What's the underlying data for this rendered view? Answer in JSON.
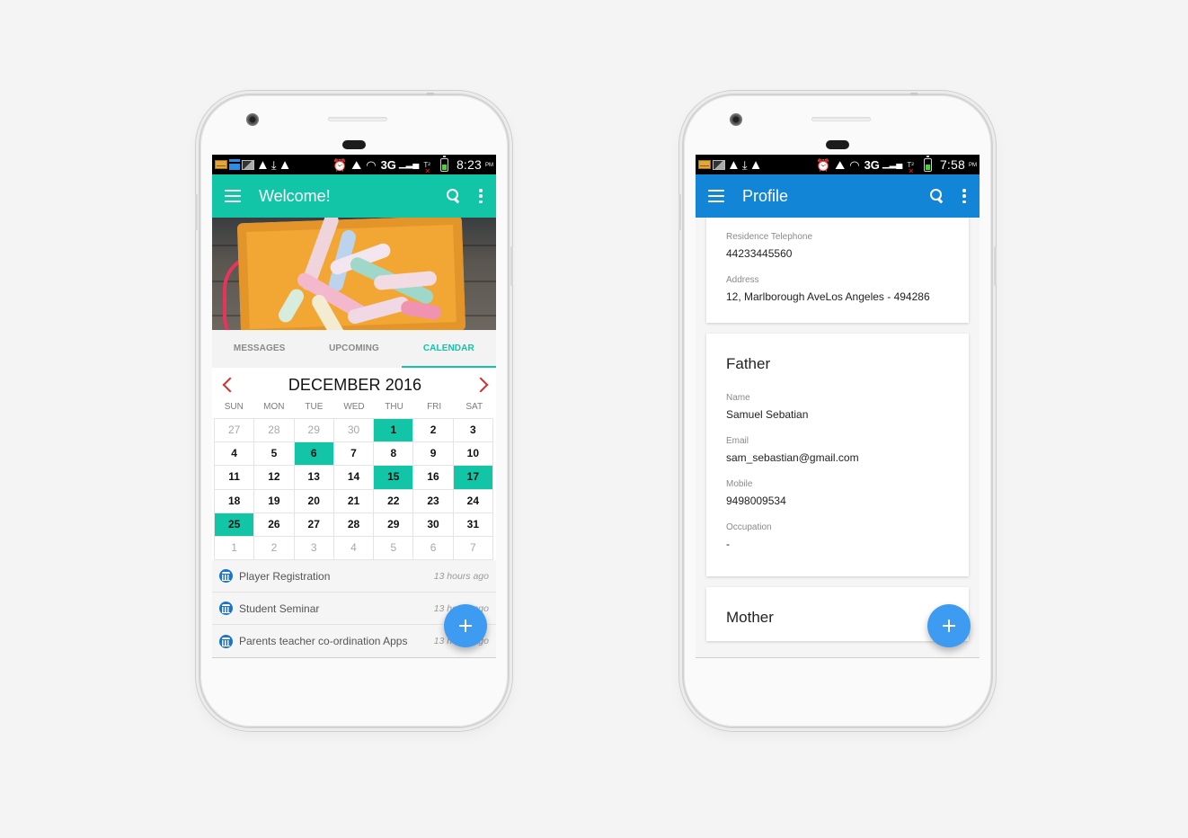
{
  "left_phone": {
    "status_bar": {
      "left_icons": [
        "mail-icon",
        "app-icon",
        "image-icon",
        "warning-icon",
        "download-icon",
        "warning-icon"
      ],
      "right_icons": [
        "alarm-icon",
        "photo-icon",
        "wifi-icon",
        "signal-icon",
        "sim-icon",
        "battery-icon"
      ],
      "network": "3G",
      "time": "8:23",
      "ampm": "PM"
    },
    "app_bar": {
      "title": "Welcome!",
      "color": "#12c5a7"
    },
    "tabs": [
      {
        "label": "MESSAGES",
        "active": false
      },
      {
        "label": "UPCOMING",
        "active": false
      },
      {
        "label": "CALENDAR",
        "active": true
      }
    ],
    "calendar": {
      "month_label": "DECEMBER 2016",
      "days_of_week": [
        "SUN",
        "MON",
        "TUE",
        "WED",
        "THU",
        "FRI",
        "SAT"
      ],
      "weeks": [
        [
          {
            "d": "27",
            "m": 1
          },
          {
            "d": "28",
            "m": 1
          },
          {
            "d": "29",
            "m": 1
          },
          {
            "d": "30",
            "m": 1
          },
          {
            "d": "1",
            "e": 1
          },
          {
            "d": "2"
          },
          {
            "d": "3"
          }
        ],
        [
          {
            "d": "4"
          },
          {
            "d": "5"
          },
          {
            "d": "6",
            "e": 1
          },
          {
            "d": "7"
          },
          {
            "d": "8"
          },
          {
            "d": "9"
          },
          {
            "d": "10"
          }
        ],
        [
          {
            "d": "11"
          },
          {
            "d": "12"
          },
          {
            "d": "13"
          },
          {
            "d": "14"
          },
          {
            "d": "15",
            "e": 1
          },
          {
            "d": "16"
          },
          {
            "d": "17",
            "e": 1
          }
        ],
        [
          {
            "d": "18"
          },
          {
            "d": "19"
          },
          {
            "d": "20"
          },
          {
            "d": "21"
          },
          {
            "d": "22"
          },
          {
            "d": "23"
          },
          {
            "d": "24"
          }
        ],
        [
          {
            "d": "25",
            "e": 1
          },
          {
            "d": "26"
          },
          {
            "d": "27"
          },
          {
            "d": "28"
          },
          {
            "d": "29"
          },
          {
            "d": "30"
          },
          {
            "d": "31"
          }
        ],
        [
          {
            "d": "1",
            "m": 1
          },
          {
            "d": "2",
            "m": 1
          },
          {
            "d": "3",
            "m": 1
          },
          {
            "d": "4",
            "m": 1
          },
          {
            "d": "5",
            "m": 1
          },
          {
            "d": "6",
            "m": 1
          },
          {
            "d": "7",
            "m": 1
          }
        ]
      ],
      "event_color": "#12c5a7"
    },
    "events": [
      {
        "title": "Player Registration",
        "time": "13 hours ago"
      },
      {
        "title": "Student Seminar",
        "time": "13 hours ago"
      },
      {
        "title": "Parents teacher co-ordination Apps",
        "time": "13 hours ago"
      }
    ],
    "fab_icon": "plus-icon"
  },
  "right_phone": {
    "status_bar": {
      "left_icons": [
        "mail-icon",
        "image-icon",
        "warning-icon",
        "download-icon",
        "warning-icon"
      ],
      "right_icons": [
        "alarm-icon",
        "photo-icon",
        "wifi-icon",
        "signal-icon",
        "sim-icon",
        "battery-icon"
      ],
      "network": "3G",
      "time": "7:58",
      "ampm": "PM"
    },
    "app_bar": {
      "title": "Profile",
      "color": "#1285d6"
    },
    "contact_card": {
      "fields": [
        {
          "label": "Residence Telephone",
          "value": "44233445560"
        },
        {
          "label": "Address",
          "value": "12, Marlborough AveLos Angeles - 494286"
        }
      ]
    },
    "father_card": {
      "title": "Father",
      "fields": [
        {
          "label": "Name",
          "value": "Samuel Sebatian"
        },
        {
          "label": "Email",
          "value": "sam_sebastian@gmail.com"
        },
        {
          "label": "Mobile",
          "value": "9498009534"
        },
        {
          "label": "Occupation",
          "value": "-"
        }
      ]
    },
    "mother_card": {
      "title": "Mother"
    },
    "fab_icon": "plus-icon"
  }
}
